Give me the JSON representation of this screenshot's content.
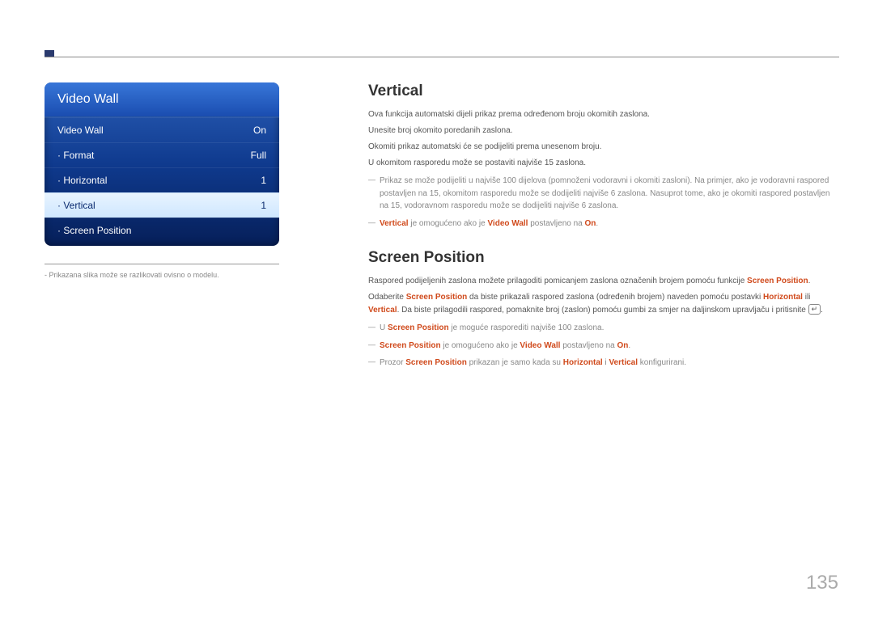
{
  "osd": {
    "title": "Video Wall",
    "rows": [
      {
        "label": "Video Wall",
        "value": "On",
        "dot": false
      },
      {
        "label": "Format",
        "value": "Full",
        "dot": true
      },
      {
        "label": "Horizontal",
        "value": "1",
        "dot": true
      },
      {
        "label": "Vertical",
        "value": "1",
        "dot": true,
        "highlight": true
      },
      {
        "label": "Screen Position",
        "value": "",
        "dot": true
      }
    ]
  },
  "caption": "- Prikazana slika može se razlikovati ovisno o modelu.",
  "section1": {
    "heading": "Vertical",
    "p1": "Ova funkcija automatski dijeli prikaz prema određenom broju okomitih zaslona.",
    "p2": "Unesite broj okomito poredanih zaslona.",
    "p3": "Okomiti prikaz automatski će se podijeliti prema unesenom broju.",
    "p4": "U okomitom rasporedu može se postaviti najviše 15 zaslona.",
    "note1": "Prikaz se može podijeliti u najviše 100 dijelova (pomnoženi vodoravni i okomiti zasloni). Na primjer, ako je vodoravni raspored postavljen na 15, okomitom rasporedu može se dodijeliti najviše 6 zaslona. Nasuprot tome, ako je okomiti raspored postavljen na 15, vodoravnom rasporedu može se dodijeliti najviše 6 zaslona.",
    "note2_parts": {
      "a": "Vertical",
      "b": " je omogućeno ako je ",
      "c": "Video Wall",
      "d": " postavljeno na ",
      "e": "On",
      "f": "."
    }
  },
  "section2": {
    "heading": "Screen Position",
    "p1_parts": {
      "a": "Raspored podijeljenih zaslona možete prilagoditi pomicanjem zaslona označenih brojem pomoću funkcije ",
      "b": "Screen Position",
      "c": "."
    },
    "p2_parts": {
      "a": "Odaberite ",
      "b": "Screen Position",
      "c": " da biste prikazali raspored zaslona (određenih brojem) naveden pomoću postavki ",
      "d": "Horizontal",
      "e": " ili ",
      "f": "Vertical",
      "g": ". Da biste prilagodili raspored, pomaknite broj (zaslon) pomoću gumbi za smjer na daljinskom upravljaču i pritisnite ",
      "h": "."
    },
    "note1_parts": {
      "a": "U ",
      "b": "Screen Position",
      "c": " je moguće rasporediti najviše 100 zaslona."
    },
    "note2_parts": {
      "a": "Screen Position",
      "b": " je omogućeno ako je ",
      "c": "Video Wall",
      "d": " postavljeno na ",
      "e": "On",
      "f": "."
    },
    "note3_parts": {
      "a": "Prozor ",
      "b": "Screen Position",
      "c": " prikazan je samo kada su ",
      "d": "Horizontal",
      "e": " i ",
      "f": "Vertical",
      "g": " konfigurirani."
    }
  },
  "pageNumber": "135",
  "enterGlyph": "↵"
}
